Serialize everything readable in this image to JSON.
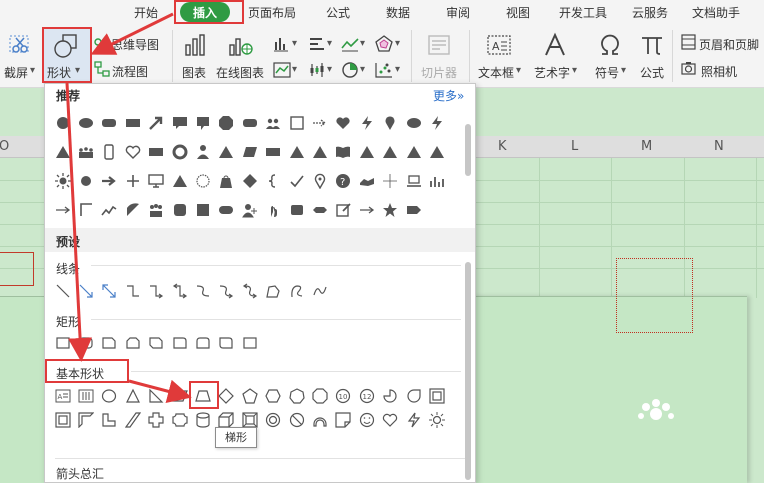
{
  "menu_tabs": [
    "开始",
    "插入",
    "页面布局",
    "公式",
    "数据",
    "审阅",
    "视图",
    "开发工具",
    "云服务",
    "文档助手"
  ],
  "ribbon": {
    "screenshot": "截屏",
    "shapes": "形状",
    "mindmap": "思维导图",
    "flowchart": "流程图",
    "chart": "图表",
    "online_chart": "在线图表",
    "slicer": "切片器",
    "textbox": "文本框",
    "wordart": "艺术字",
    "symbol": "符号",
    "formula": "公式",
    "header_footer": "页眉和页脚",
    "camera": "照相机"
  },
  "sheet": {
    "columns": [
      "O",
      "K",
      "L",
      "M",
      "N"
    ]
  },
  "panel": {
    "recommended": "推荐",
    "more": "更多",
    "presets": "预设",
    "lines": "线条",
    "rectangles": "矩形",
    "basic_shapes": "基本形状",
    "arrows": "箭头总汇",
    "badge_10": "10",
    "badge_12": "12"
  },
  "tooltip": "梯形",
  "colors": {
    "accent_green": "#2f9b43",
    "annotation_red": "#e03a3a",
    "sheet_green": "#cce8cc"
  }
}
